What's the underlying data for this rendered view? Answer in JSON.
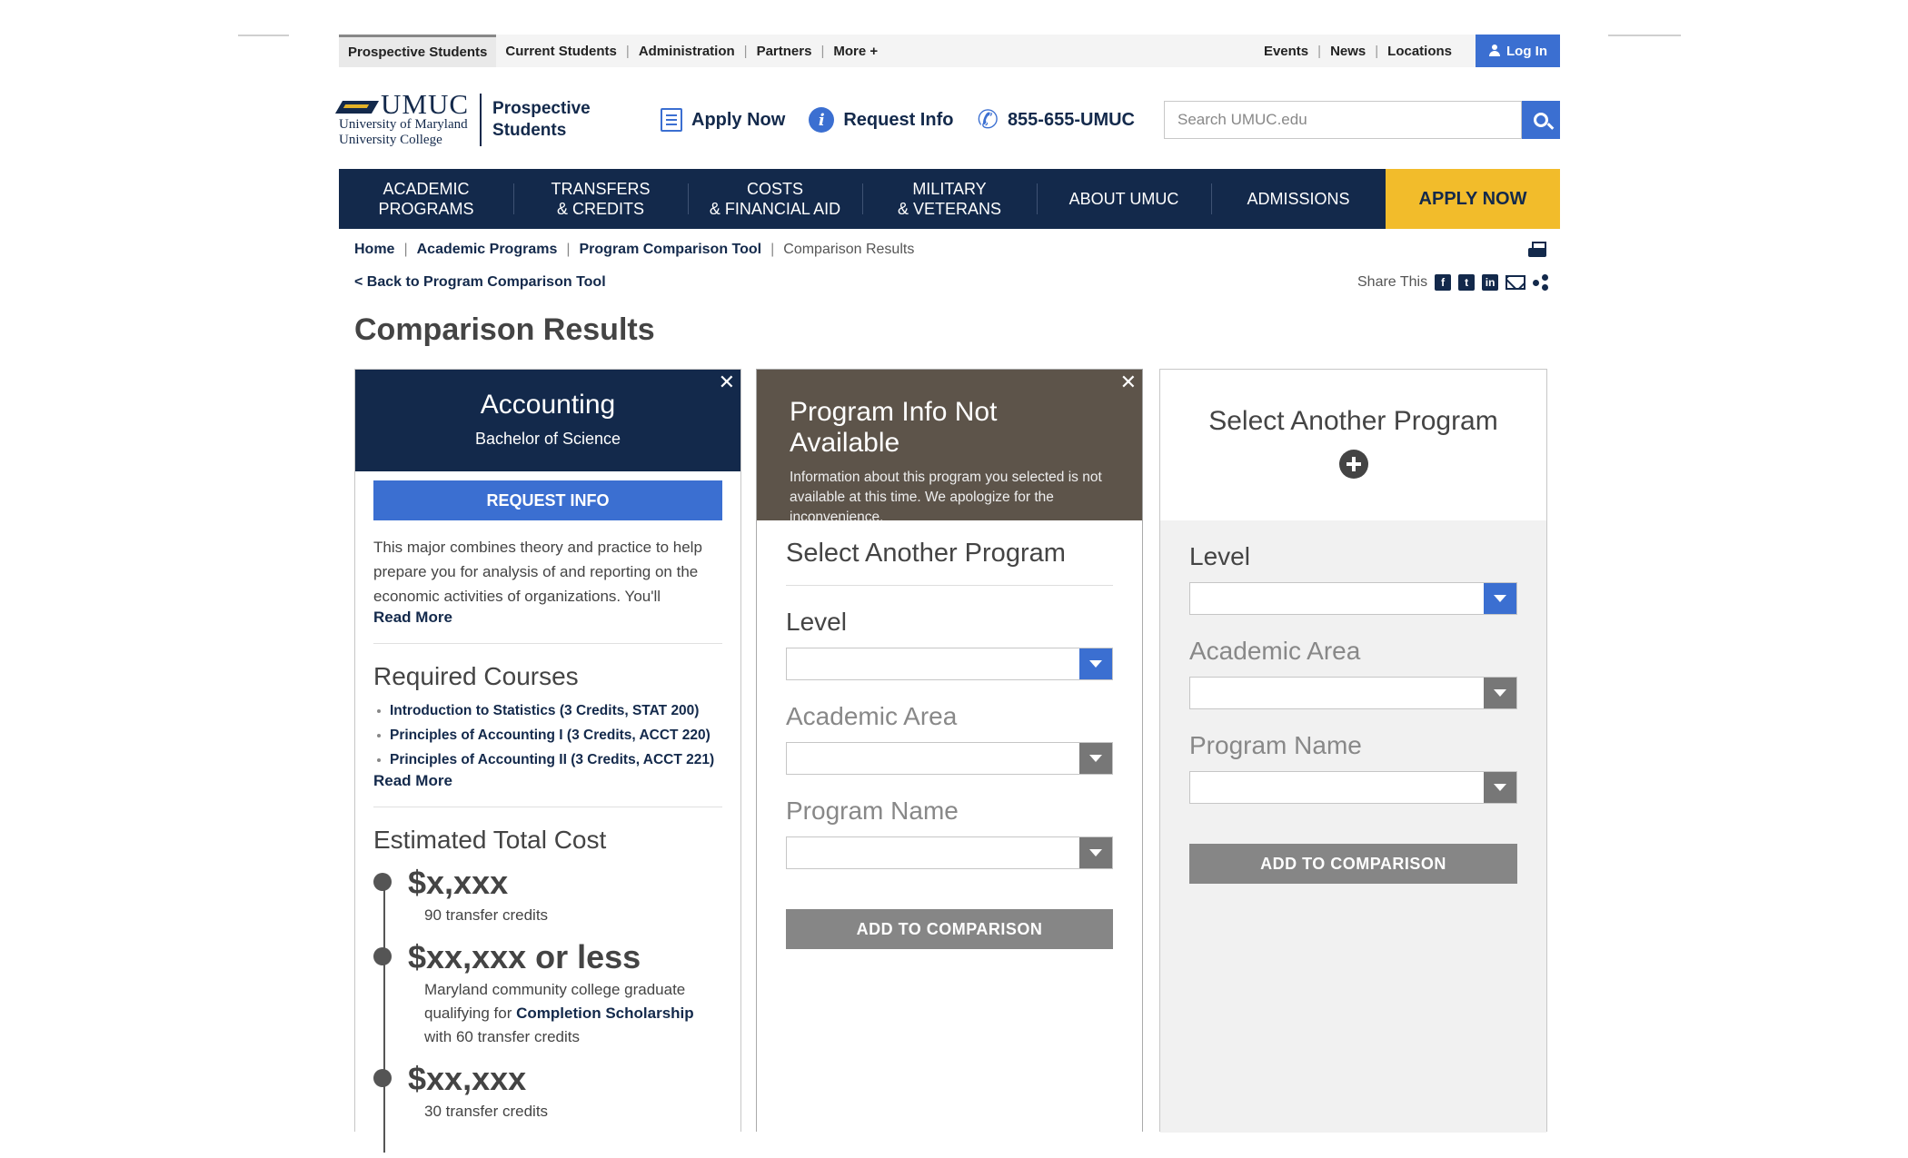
{
  "utility": {
    "tabs": [
      "Prospective Students",
      "Current Students",
      "Administration",
      "Partners",
      "More +"
    ],
    "right_links": [
      "Events",
      "News",
      "Locations"
    ],
    "login": "Log In"
  },
  "header": {
    "logo_name": "UMUC",
    "logo_line1": "University of Maryland",
    "logo_line2": "University College",
    "logo_sub1": "Prospective",
    "logo_sub2": "Students",
    "apply": "Apply Now",
    "request": "Request Info",
    "phone": "855-655-UMUC",
    "search_placeholder": "Search UMUC.edu"
  },
  "nav": {
    "items": [
      {
        "l1": "ACADEMIC",
        "l2": "PROGRAMS"
      },
      {
        "l1": "TRANSFERS",
        "l2": "& CREDITS"
      },
      {
        "l1": "COSTS",
        "l2": "& FINANCIAL AID"
      },
      {
        "l1": "MILITARY",
        "l2": "& VETERANS"
      },
      {
        "l1": "ABOUT UMUC",
        "l2": ""
      },
      {
        "l1": "ADMISSIONS",
        "l2": ""
      }
    ],
    "apply": "APPLY NOW"
  },
  "breadcrumb": [
    "Home",
    "Academic Programs",
    "Program Comparison Tool",
    "Comparison Results"
  ],
  "back_link": "< Back to Program Comparison Tool",
  "share_label": "Share This",
  "page_title": "Comparison Results",
  "col1": {
    "title": "Accounting",
    "subtitle": "Bachelor of Science",
    "request_btn": "REQUEST INFO",
    "description": "This major combines theory and practice to help prepare you for analysis of and reporting on the economic activities of organizations. You'll",
    "read_more": "Read More",
    "courses_heading": "Required Courses",
    "courses": [
      "Introduction to Statistics (3 Credits, STAT 200)",
      "Principles of Accounting I (3 Credits, ACCT 220)",
      "Principles of Accounting II (3 Credits, ACCT 221)"
    ],
    "courses_read_more": "Read More",
    "cost_heading": "Estimated Total Cost",
    "costs": [
      {
        "amount": "$x,xxx",
        "note": "90 transfer credits"
      },
      {
        "amount": "$xx,xxx or less",
        "note_pre": "Maryland community college graduate qualifying for ",
        "note_link": "Completion Scholarship",
        "note_post": " with 60 transfer credits"
      },
      {
        "amount": "$xx,xxx",
        "note": "30 transfer credits"
      }
    ]
  },
  "col2": {
    "title": "Program Info Not Available",
    "message": "Information about this program you selected is not available at this time. We apologize for the inconvenience.",
    "select_title": "Select Another Program",
    "level_label": "Level",
    "area_label": "Academic Area",
    "program_label": "Program Name",
    "add_btn": "ADD TO COMPARISON"
  },
  "col3": {
    "title": "Select Another Program",
    "level_label": "Level",
    "area_label": "Academic Area",
    "program_label": "Program Name",
    "add_btn": "ADD TO COMPARISON"
  },
  "colors": {
    "navy": "#13294b",
    "blue": "#3b6fd1",
    "gold": "#f2bc2b",
    "grey_header": "#5d544a"
  }
}
